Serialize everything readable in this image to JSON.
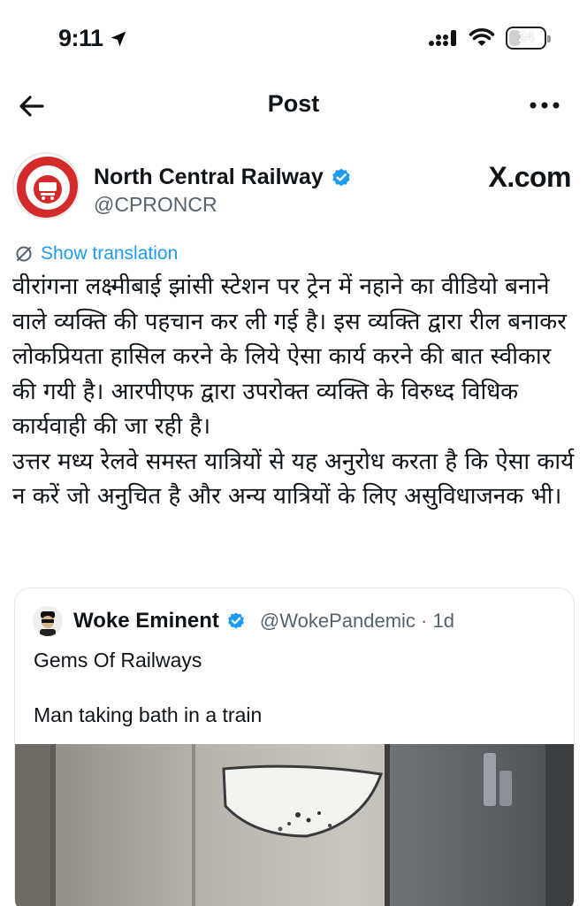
{
  "status": {
    "time": "9:11",
    "battery": "24"
  },
  "nav": {
    "title": "Post"
  },
  "post": {
    "author_name": "North Central Railway",
    "handle": "@CPRONCR",
    "site_label": "X.com",
    "show_translation": "Show translation",
    "body_paragraphs": [
      "वीरांगना लक्ष्मीबाई झांसी स्टेशन पर ट्रेन में नहाने का वीडियो बनाने वाले व्यक्ति की पहचान कर ली गई है। इस व्यक्ति द्वारा रील बनाकर लोकप्रियता हासिल करने के लिये ऐसा कार्य करने की बात स्वीकार की गयी है। आरपीएफ द्वारा उपरोक्त व्यक्ति के विरुध्द विधिक कार्यवाही की जा रही है।",
      "उत्तर मध्य रेलवे समस्त यात्रियों से यह अनुरोध करता है कि ऐसा कार्य न करें जो अनुचित है और अन्य यात्रियों के लिए असुविधाजनक भी।"
    ]
  },
  "quote": {
    "author_name": "Woke Eminent",
    "handle_time": "@WokePandemic · 1d",
    "line1": "Gems Of Railways",
    "line2": "Man taking bath in a train"
  },
  "colors": {
    "accent": "#1d9bf0",
    "muted": "#536471",
    "text": "#0f1419"
  },
  "icons": [
    "location-arrow-icon",
    "cellular-signal-icon",
    "wifi-icon",
    "battery-icon",
    "back-arrow-icon",
    "more-options-icon",
    "verified-badge-icon",
    "translate-icon"
  ]
}
